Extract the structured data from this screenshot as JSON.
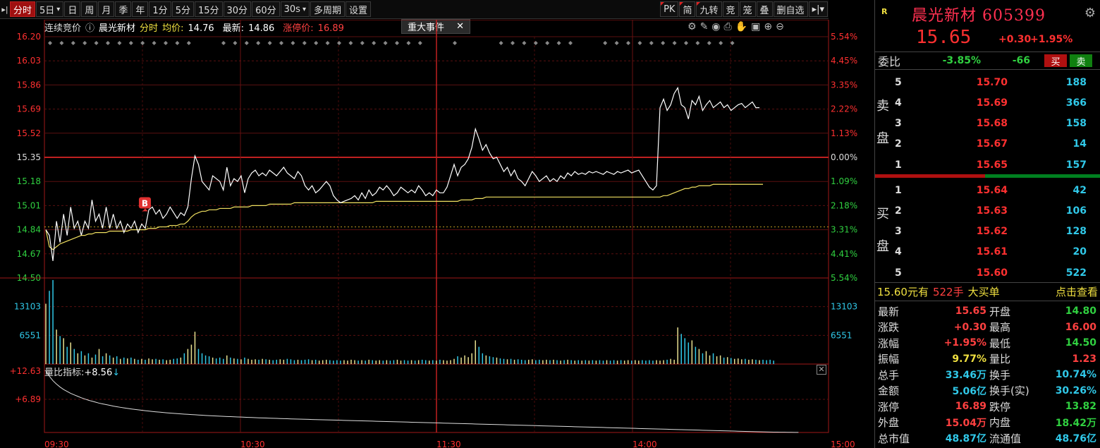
{
  "toolbar": {
    "pin": "▸|",
    "periods": [
      "分时",
      "5日",
      "日",
      "周",
      "月",
      "季",
      "年",
      "1分",
      "5分",
      "15分",
      "30分",
      "60分"
    ],
    "interval": "30s",
    "multi_period": "多周期",
    "settings": "设置",
    "right_tools": [
      "PK",
      "简",
      "九转",
      "竞",
      "笼",
      "叠",
      "删自选"
    ]
  },
  "info": {
    "auction": "连续竞价",
    "stock_name": "晨光新材",
    "mode": "分时",
    "avg_label": "均价:",
    "avg_value": "14.76",
    "latest_label": "最新:",
    "latest_value": "14.86",
    "limit_label": "涨停价:",
    "limit_value": "16.89",
    "event_button": "重大事件",
    "indicator_label": "量比指标:",
    "indicator_value": "+8.56"
  },
  "chart_data": {
    "type": "line",
    "prev_close": 15.35,
    "y_ticks_left": [
      "16.20",
      "16.03",
      "15.86",
      "15.69",
      "15.52",
      "15.35",
      "15.18",
      "15.01",
      "14.84",
      "14.67",
      "14.50"
    ],
    "y_ticks_right": [
      "5.54%",
      "4.45%",
      "3.35%",
      "2.22%",
      "1.13%",
      "0.00%",
      "1.09%",
      "2.18%",
      "3.31%",
      "4.41%",
      "5.54%"
    ],
    "ylim": [
      14.5,
      16.2
    ],
    "vol_ticks": [
      "13103",
      "6551"
    ],
    "vol_max": 19654,
    "ratio_ticks": [
      "+12.63",
      "+6.89"
    ],
    "x_ticks": [
      "09:30",
      "10:30",
      "11:30",
      "14:00",
      "15:00"
    ],
    "marker_label": "B",
    "price": [
      14.84,
      14.8,
      14.62,
      14.9,
      14.75,
      14.95,
      14.8,
      15.0,
      14.85,
      14.9,
      14.8,
      14.9,
      14.85,
      15.05,
      14.9,
      14.95,
      14.85,
      15.0,
      14.85,
      14.95,
      14.85,
      14.9,
      14.82,
      14.88,
      14.85,
      14.9,
      14.82,
      14.88,
      14.85,
      14.98,
      15.0,
      14.95,
      14.98,
      14.92,
      14.95,
      15.0,
      14.96,
      14.92,
      14.96,
      14.94,
      15.0,
      15.2,
      15.36,
      15.3,
      15.18,
      15.15,
      15.12,
      15.22,
      15.2,
      15.18,
      15.12,
      15.28,
      15.15,
      15.2,
      15.18,
      15.22,
      15.1,
      15.2,
      15.24,
      15.26,
      15.22,
      15.24,
      15.22,
      15.26,
      15.24,
      15.22,
      15.25,
      15.28,
      15.24,
      15.22,
      15.2,
      15.25,
      15.22,
      15.15,
      15.12,
      15.15,
      15.1,
      15.12,
      15.15,
      15.18,
      15.15,
      15.08,
      15.05,
      15.03,
      15.04,
      15.05,
      15.06,
      15.08,
      15.05,
      15.1,
      15.06,
      15.12,
      15.08,
      15.1,
      15.14,
      15.12,
      15.15,
      15.12,
      15.08,
      15.1,
      15.14,
      15.12,
      15.1,
      15.12,
      15.1,
      15.15,
      15.12,
      15.08,
      15.1,
      15.08,
      15.12,
      15.1,
      15.1,
      15.14,
      15.22,
      15.3,
      15.22,
      15.28,
      15.3,
      15.34,
      15.42,
      15.55,
      15.48,
      15.4,
      15.44,
      15.38,
      15.34,
      15.35,
      15.3,
      15.25,
      15.28,
      15.22,
      15.26,
      15.2,
      15.18,
      15.15,
      15.2,
      15.25,
      15.22,
      15.18,
      15.2,
      15.22,
      15.18,
      15.2,
      15.18,
      15.22,
      15.2,
      15.24,
      15.22,
      15.25,
      15.23,
      15.24,
      15.23,
      15.25,
      15.24,
      15.25,
      15.24,
      15.23,
      15.25,
      15.24,
      15.23,
      15.25,
      15.24,
      15.25,
      15.26,
      15.24,
      15.25,
      15.26,
      15.22,
      15.18,
      15.14,
      15.12,
      15.15,
      15.7,
      15.76,
      15.68,
      15.72,
      15.8,
      15.84,
      15.72,
      15.7,
      15.62,
      15.75,
      15.72,
      15.78,
      15.68,
      15.72,
      15.75,
      15.7,
      15.72,
      15.74,
      15.7,
      15.72,
      15.68,
      15.7,
      15.72,
      15.73,
      15.7,
      15.72,
      15.74,
      15.7,
      15.7
    ],
    "avg": [
      14.84,
      14.72,
      14.7,
      14.72,
      14.74,
      14.75,
      14.76,
      14.77,
      14.78,
      14.79,
      14.8,
      14.8,
      14.81,
      14.81,
      14.82,
      14.82,
      14.82,
      14.82,
      14.83,
      14.83,
      14.83,
      14.83,
      14.83,
      14.83,
      14.84,
      14.84,
      14.84,
      14.84,
      14.84,
      14.85,
      14.85,
      14.85,
      14.86,
      14.86,
      14.86,
      14.87,
      14.87,
      14.87,
      14.88,
      14.88,
      14.9,
      14.93,
      14.95,
      14.96,
      14.97,
      14.97,
      14.98,
      14.98,
      14.98,
      14.99,
      14.99,
      14.99,
      14.99,
      15.0,
      15.0,
      15.0,
      15.0,
      15.0,
      15.01,
      15.01,
      15.01,
      15.01,
      15.01,
      15.02,
      15.02,
      15.02,
      15.02,
      15.02,
      15.02,
      15.02,
      15.03,
      15.03,
      15.03,
      15.03,
      15.03,
      15.03,
      15.03,
      15.03,
      15.03,
      15.03,
      15.03,
      15.03,
      15.03,
      15.03,
      15.03,
      15.03,
      15.03,
      15.03,
      15.03,
      15.03,
      15.03,
      15.03,
      15.03,
      15.04,
      15.04,
      15.04,
      15.04,
      15.04,
      15.04,
      15.04,
      15.04,
      15.04,
      15.04,
      15.04,
      15.04,
      15.04,
      15.04,
      15.04,
      15.04,
      15.04,
      15.04,
      15.04,
      15.04,
      15.04,
      15.04,
      15.04,
      15.04,
      15.05,
      15.05,
      15.05,
      15.05,
      15.06,
      15.06,
      15.06,
      15.07,
      15.07,
      15.07,
      15.07,
      15.07,
      15.07,
      15.07,
      15.07,
      15.07,
      15.07,
      15.07,
      15.07,
      15.07,
      15.07,
      15.07,
      15.07,
      15.07,
      15.07,
      15.07,
      15.07,
      15.07,
      15.07,
      15.07,
      15.07,
      15.07,
      15.07,
      15.07,
      15.07,
      15.07,
      15.07,
      15.07,
      15.07,
      15.07,
      15.07,
      15.07,
      15.07,
      15.07,
      15.07,
      15.07,
      15.07,
      15.07,
      15.07,
      15.07,
      15.07,
      15.07,
      15.07,
      15.07,
      15.07,
      15.07,
      15.07,
      15.08,
      15.08,
      15.09,
      15.1,
      15.11,
      15.12,
      15.13,
      15.13,
      15.14,
      15.14,
      15.15,
      15.15,
      15.15,
      15.15,
      15.16,
      15.16,
      15.16,
      15.16,
      15.16,
      15.16,
      15.16,
      15.16,
      15.16,
      15.16,
      15.16,
      15.16,
      15.16,
      15.16,
      15.16
    ],
    "volume": [
      14000,
      17000,
      19500,
      8000,
      6500,
      6000,
      4000,
      5000,
      3500,
      2500,
      3000,
      2000,
      2500,
      1500,
      2200,
      3500,
      1800,
      2500,
      2000,
      1500,
      1800,
      1200,
      1500,
      1300,
      1500,
      1200,
      1000,
      1200,
      1000,
      1300,
      1100,
      1200,
      1000,
      1100,
      900,
      1000,
      1200,
      1300,
      1500,
      2500,
      3500,
      4500,
      7500,
      3500,
      2500,
      2000,
      1800,
      1500,
      1300,
      1500,
      1200,
      2000,
      1500,
      1300,
      1200,
      1100,
      1500,
      1200,
      1000,
      1100,
      1000,
      1200,
      1100,
      1000,
      900,
      1000,
      1100,
      1000,
      1200,
      1100,
      900,
      1000,
      900,
      1000,
      1100,
      900,
      1000,
      800,
      900,
      1000,
      900,
      800,
      900,
      800,
      900,
      800,
      1000,
      900,
      800,
      900,
      800,
      1000,
      900,
      800,
      900,
      800,
      900,
      800,
      900,
      1000,
      800,
      900,
      800,
      900,
      800,
      900,
      1000,
      900,
      800,
      900,
      800,
      1000,
      900,
      800,
      900,
      1200,
      1800,
      1500,
      2000,
      1600,
      2500,
      5500,
      4000,
      2500,
      2000,
      1800,
      1600,
      1500,
      1300,
      1200,
      1100,
      1200,
      1000,
      1100,
      1000,
      900,
      1000,
      1100,
      900,
      1000,
      900,
      1000,
      900,
      1000,
      900,
      800,
      900,
      1000,
      900,
      800,
      900,
      800,
      900,
      800,
      900,
      800,
      900,
      800,
      900,
      800,
      900,
      800,
      900,
      800,
      900,
      800,
      900,
      800,
      900,
      800,
      900,
      800,
      900,
      800,
      900,
      1000,
      1200,
      1000,
      8500,
      7000,
      6000,
      5000,
      5500,
      4000,
      3500,
      2500,
      3000,
      2000,
      2500,
      1800,
      2000,
      1500,
      1600,
      1400,
      1200,
      1300,
      1100,
      1200,
      1000,
      1100,
      1000,
      900,
      1000,
      900,
      1000,
      800
    ],
    "ratio": [
      12.63,
      11.5,
      10.6,
      9.9,
      9.3,
      8.8,
      8.4,
      8.0,
      7.7,
      7.4,
      7.1,
      6.85,
      6.6,
      6.4,
      6.2,
      6.0,
      5.85,
      5.7,
      5.55,
      5.4,
      5.27,
      5.15,
      5.03,
      4.92,
      4.82,
      4.72,
      4.63,
      4.54,
      4.46,
      4.38,
      4.3,
      4.23,
      4.16,
      4.09,
      4.03,
      3.97,
      3.91,
      3.86,
      3.81,
      3.76,
      3.71,
      3.66,
      3.62,
      3.57,
      3.53,
      3.49,
      3.45,
      3.41,
      3.38,
      3.34,
      3.31,
      3.27,
      3.24,
      3.21,
      3.18,
      3.15,
      3.12,
      3.09,
      3.06,
      3.03,
      3.0,
      2.98,
      2.95,
      2.93,
      2.9,
      2.88,
      2.85,
      2.83,
      2.81,
      2.78,
      2.76,
      2.74,
      2.72,
      2.7,
      2.68,
      2.66,
      2.64,
      2.62,
      2.6,
      2.58,
      2.56,
      2.54,
      2.52,
      2.5,
      2.48,
      2.46,
      2.44,
      2.42,
      2.4,
      2.38,
      2.36,
      2.34,
      2.32,
      2.3,
      2.28,
      2.26,
      2.24,
      2.22,
      2.2,
      2.18,
      2.16,
      2.14,
      2.12,
      2.1,
      2.08,
      2.06,
      2.04,
      2.02,
      2.0,
      1.98,
      1.96,
      1.94,
      1.92,
      1.9,
      1.88,
      1.86,
      1.84,
      1.82,
      1.8,
      1.78,
      1.76,
      1.74,
      1.72,
      1.7,
      1.68,
      1.66,
      1.64,
      1.62,
      1.6,
      1.58,
      1.56,
      1.54,
      1.52,
      1.5,
      1.48,
      1.46,
      1.44,
      1.42,
      1.4,
      1.38,
      1.36,
      1.34,
      1.32,
      1.3,
      1.28,
      1.26,
      1.24,
      1.22,
      1.2,
      1.18,
      1.16,
      1.14,
      1.12,
      1.1,
      1.08,
      1.06,
      1.04,
      1.02,
      1.0,
      0.98,
      0.96,
      0.94,
      0.92,
      0.9,
      0.88,
      0.86,
      0.84,
      0.82,
      0.8,
      0.78,
      0.76,
      0.74,
      0.72,
      0.7,
      0.68,
      0.66,
      0.64,
      0.62,
      0.6,
      0.58,
      0.56,
      0.54,
      0.52,
      0.5,
      0.48,
      0.46,
      0.44,
      0.42,
      0.4,
      0.38,
      0.36,
      0.34,
      0.32,
      0.3,
      0.28,
      0.26,
      0.24,
      0.22,
      0.2,
      0.18,
      0.16,
      0.14,
      0.12,
      0.1,
      0.09,
      0.08,
      0.07,
      0.06,
      0.05,
      0.04,
      0.03,
      0.02,
      0.01
    ]
  },
  "panel": {
    "badge": "R",
    "name": "晨光新材 605399",
    "price": "15.65",
    "change": "+0.30",
    "change_pct": "+1.95%",
    "webi_label": "委比",
    "webi_pct": "-3.85%",
    "webi_diff": "-66",
    "buy_btn": "买",
    "sell_btn": "卖",
    "sell_side_label": [
      "卖",
      "盘"
    ],
    "buy_side_label": [
      "买",
      "盘"
    ],
    "asks": [
      {
        "lvl": "5",
        "price": "15.70",
        "vol": "188"
      },
      {
        "lvl": "4",
        "price": "15.69",
        "vol": "366"
      },
      {
        "lvl": "3",
        "price": "15.68",
        "vol": "158"
      },
      {
        "lvl": "2",
        "price": "15.67",
        "vol": "14"
      },
      {
        "lvl": "1",
        "price": "15.65",
        "vol": "157"
      }
    ],
    "bids": [
      {
        "lvl": "1",
        "price": "15.64",
        "vol": "42"
      },
      {
        "lvl": "2",
        "price": "15.63",
        "vol": "106"
      },
      {
        "lvl": "3",
        "price": "15.62",
        "vol": "128"
      },
      {
        "lvl": "4",
        "price": "15.61",
        "vol": "20"
      },
      {
        "lvl": "5",
        "price": "15.60",
        "vol": "522"
      }
    ],
    "big_order": {
      "price": "15.60元有",
      "qty": "522手",
      "label": "大买单",
      "link": "点击查看"
    },
    "stats": [
      {
        "l": "最新",
        "v": "15.65",
        "vc": "red",
        "l2": "开盘",
        "v2": "14.80",
        "v2c": "green"
      },
      {
        "l": "涨跌",
        "v": "+0.30",
        "vc": "red",
        "l2": "最高",
        "v2": "16.00",
        "v2c": "red"
      },
      {
        "l": "涨幅",
        "v": "+1.95%",
        "vc": "red",
        "l2": "最低",
        "v2": "14.50",
        "v2c": "green"
      },
      {
        "l": "振幅",
        "v": "9.77%",
        "vc": "yellow",
        "l2": "量比",
        "v2": "1.23",
        "v2c": "red"
      },
      {
        "l": "总手",
        "v": "33.46万",
        "vc": "cyan",
        "l2": "换手",
        "v2": "10.74%",
        "v2c": "cyan"
      },
      {
        "l": "金额",
        "v": "5.06亿",
        "vc": "cyan",
        "l2": "换手(实)",
        "v2": "30.26%",
        "v2c": "cyan"
      },
      {
        "l": "涨停",
        "v": "16.89",
        "vc": "red",
        "l2": "跌停",
        "v2": "13.82",
        "v2c": "green"
      },
      {
        "l": "外盘",
        "v": "15.04万",
        "vc": "red",
        "l2": "内盘",
        "v2": "18.42万",
        "v2c": "green"
      },
      {
        "l": "总市值",
        "v": "48.87亿",
        "vc": "cyan",
        "l2": "流通值",
        "v2": "48.76亿",
        "v2c": "cyan"
      }
    ]
  }
}
